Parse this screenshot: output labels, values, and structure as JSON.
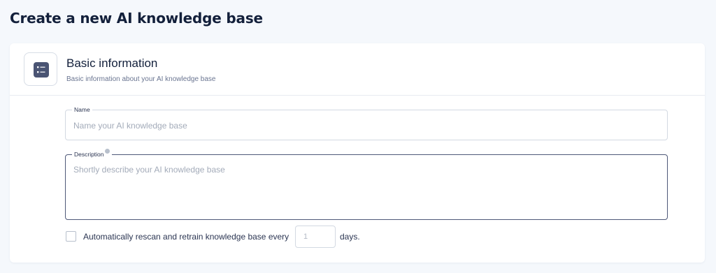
{
  "page": {
    "title": "Create a new AI knowledge base"
  },
  "section": {
    "icon": "list-icon",
    "title": "Basic information",
    "subtitle": "Basic information about your AI knowledge base"
  },
  "fields": {
    "name": {
      "label": "Name",
      "value": "",
      "placeholder": "Name your AI knowledge base"
    },
    "description": {
      "label": "Description",
      "value": "",
      "placeholder": "Shortly describe your AI knowledge base",
      "info_icon": "info-icon"
    }
  },
  "rescan": {
    "checked": false,
    "label": "Automatically rescan and retrain knowledge base every",
    "days_value": "",
    "days_placeholder": "1",
    "suffix": "days."
  },
  "colors": {
    "background": "#f5f8fc",
    "title": "#13203b",
    "icon_fill": "#4a5473",
    "active_border": "#4e5878"
  }
}
